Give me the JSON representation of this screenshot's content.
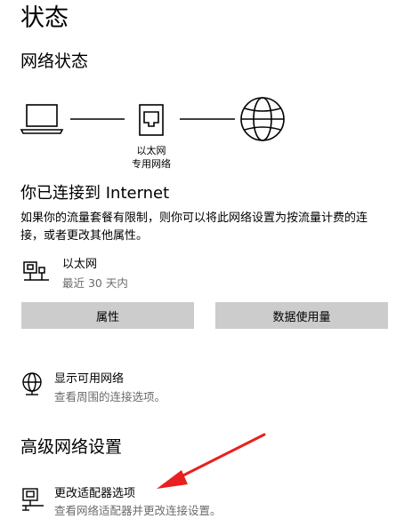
{
  "page": {
    "title": "状态"
  },
  "network_status": {
    "heading": "网络状态",
    "adapter_label_line1": "以太网",
    "adapter_label_line2": "专用网络",
    "connected_heading": "你已连接到 Internet",
    "description": "如果你的流量套餐有限制，则你可以将此网络设置为按流量计费的连接，或者更改其他属性。",
    "connection": {
      "name": "以太网",
      "usage": "最近 30 天内"
    },
    "buttons": {
      "properties": "属性",
      "data_usage": "数据使用量"
    }
  },
  "show_networks": {
    "title": "显示可用网络",
    "subtitle": "查看周围的连接选项。"
  },
  "advanced": {
    "heading": "高级网络设置",
    "change_adapter": {
      "title": "更改适配器选项",
      "subtitle": "查看网络适配器并更改连接设置。"
    }
  },
  "annotation": {
    "arrow_color": "#e8201e"
  },
  "colors": {
    "button_bg": "#cccccc",
    "secondary_text": "#6b6b6b"
  }
}
